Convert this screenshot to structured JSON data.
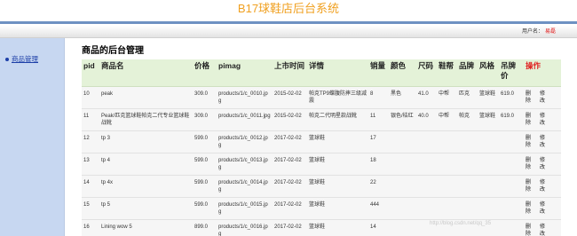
{
  "header": {
    "site_title": "B17球鞋店后台系统",
    "user_label": "用户名：",
    "username": "易磊"
  },
  "sidebar": {
    "items": [
      {
        "label": "商品管理"
      }
    ]
  },
  "main": {
    "title": "商品的后台管理",
    "columns": [
      "pid",
      "商品名",
      "价格",
      "pimag",
      "上市时间",
      "详情",
      "销量",
      "颜色",
      "尺码",
      "鞋帮",
      "品牌",
      "风格",
      "吊牌价",
      "操作"
    ],
    "rows": [
      {
        "pid": "10",
        "name": "peak",
        "price": "309.0",
        "pimag": "products/1/c_0010.jpg",
        "date": "2015-02-02",
        "detail": "帕克TP9蝶腹防摔三级减震",
        "sales": "8",
        "color": "黑色",
        "size": "41.0",
        "upper": "中帮",
        "brand": "匹克",
        "style": "篮球鞋",
        "tag_price": "619.0",
        "delete": "删除",
        "edit": "修改"
      },
      {
        "pid": "11",
        "name": "Peak/匹克篮球鞋帕克二代专业篮球鞋战靴",
        "price": "309.0",
        "pimag": "products/1/c_0011.jpg",
        "date": "2015-02-02",
        "detail": "帕克二代明星款战靴",
        "sales": "11",
        "color": "银色/桔红",
        "size": "40.0",
        "upper": "中帮",
        "brand": "帕克",
        "style": "篮球鞋",
        "tag_price": "619.0",
        "delete": "删除",
        "edit": "修改"
      },
      {
        "pid": "12",
        "name": "tp 3",
        "price": "599.0",
        "pimag": "products/1/c_0012.jpg",
        "date": "2017-02-02",
        "detail": "篮球鞋",
        "sales": "17",
        "color": "",
        "size": "",
        "upper": "",
        "brand": "",
        "style": "",
        "tag_price": "",
        "delete": "删除",
        "edit": "修改"
      },
      {
        "pid": "13",
        "name": "tp 4",
        "price": "599.0",
        "pimag": "products/1/c_0013.jpg",
        "date": "2017-02-02",
        "detail": "篮球鞋",
        "sales": "18",
        "color": "",
        "size": "",
        "upper": "",
        "brand": "",
        "style": "",
        "tag_price": "",
        "delete": "删除",
        "edit": "修改"
      },
      {
        "pid": "14",
        "name": "tp 4x",
        "price": "599.0",
        "pimag": "products/1/c_0014.jpg",
        "date": "2017-02-02",
        "detail": "篮球鞋",
        "sales": "22",
        "color": "",
        "size": "",
        "upper": "",
        "brand": "",
        "style": "",
        "tag_price": "",
        "delete": "删除",
        "edit": "修改"
      },
      {
        "pid": "15",
        "name": "tp 5",
        "price": "599.0",
        "pimag": "products/1/c_0015.jpg",
        "date": "2017-02-02",
        "detail": "篮球鞋",
        "sales": "444",
        "color": "",
        "size": "",
        "upper": "",
        "brand": "",
        "style": "",
        "tag_price": "",
        "delete": "删除",
        "edit": "修改"
      },
      {
        "pid": "16",
        "name": "Lining wow 5",
        "price": "899.0",
        "pimag": "products/1/c_0016.jpg",
        "date": "2017-02-02",
        "detail": "篮球鞋",
        "sales": "14",
        "color": "",
        "size": "",
        "upper": "",
        "brand": "",
        "style": "",
        "tag_price": "",
        "delete": "删除",
        "edit": "修改"
      }
    ]
  },
  "watermark": "http://blog.csdn.net/qq_35"
}
